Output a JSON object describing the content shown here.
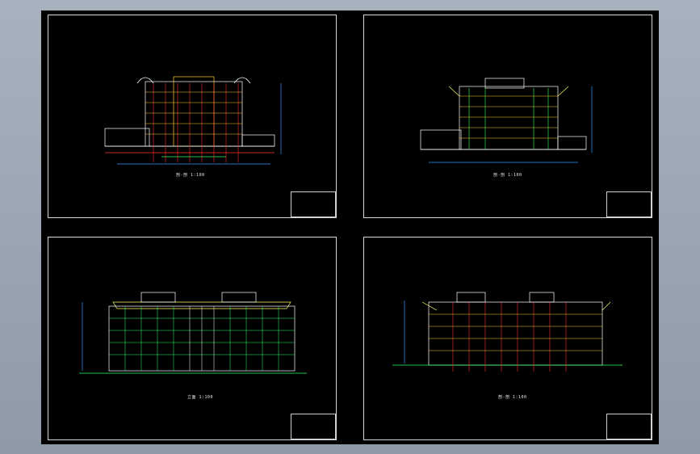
{
  "workspace": {
    "background_color": "#9aa6b3",
    "model_space_color": "#000000",
    "line_colors": {
      "frame": "#d8d8d8",
      "structure": "#ffffff",
      "columns": "#ff3333",
      "floors": "#ffcc33",
      "glass": "#33ff66",
      "annotation": "#3399ff",
      "roof": "#ffff66"
    }
  },
  "sheets": [
    {
      "id": "sheet-1",
      "view": "section",
      "label": "剖-剖 1:100"
    },
    {
      "id": "sheet-2",
      "view": "section",
      "label": "剖-剖 1:100"
    },
    {
      "id": "sheet-3",
      "view": "elevation",
      "label": "立面 1:100"
    },
    {
      "id": "sheet-4",
      "view": "section",
      "label": "剖-剖 1:100"
    }
  ]
}
